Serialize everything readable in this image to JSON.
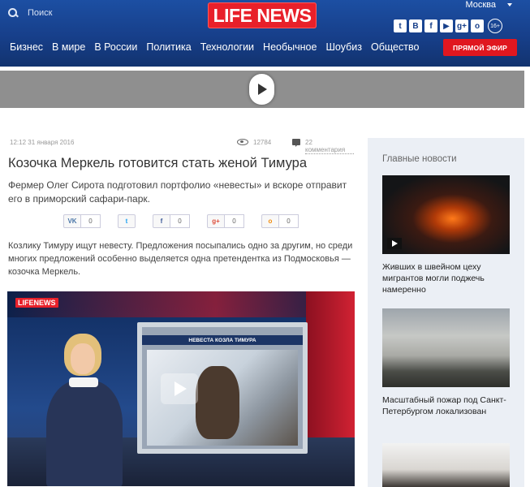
{
  "header": {
    "search_label": "Поиск",
    "logo_part1": "LIFE",
    "logo_part2": "NEWS",
    "city": "Москва",
    "socials": [
      "twitter-icon",
      "vk-icon",
      "facebook-icon",
      "youtube-icon",
      "googleplus-icon",
      "odnoklassniki-icon"
    ],
    "social_glyphs": [
      "t",
      "В",
      "f",
      "▶",
      "g+",
      "о"
    ],
    "age_rating": "16+",
    "nav": [
      "Бизнес",
      "В мире",
      "В России",
      "Политика",
      "Технологии",
      "Необычное",
      "Шоубиз",
      "Общество"
    ],
    "live_button": "ПРЯМОЙ ЭФИР",
    "colors": {
      "header_blue": "#173f8a",
      "brand_red": "#e8202a",
      "live_red": "#e0171f"
    }
  },
  "article": {
    "date": "12:12 31 января 2016",
    "views": "12784",
    "comments": "22 комментария",
    "title": "Козочка Меркель готовится стать женой Тимура",
    "lead": "Фермер Олег Сирота подготовил портфолио «невесты» и вскоре отправит его в приморский сафари-парк.",
    "share": [
      {
        "icon": "vk-icon",
        "glyph": "VK",
        "count": "0"
      },
      {
        "icon": "twitter-icon",
        "glyph": "t",
        "count": ""
      },
      {
        "icon": "facebook-icon",
        "glyph": "f",
        "count": "0"
      },
      {
        "icon": "googleplus-icon",
        "glyph": "g+",
        "count": "0"
      },
      {
        "icon": "odnoklassniki-icon",
        "glyph": "о",
        "count": "0"
      }
    ],
    "body": "Козлику Тимуру ищут невесту. Предложения посыпались одно за другим, но среди многих предложений особенно выделяется одна претендентка из Подмосковья — козочка Меркель.",
    "video": {
      "logo": "LIFENEWS",
      "screen_caption": "НЕВЕСТА КОЗЛА ТИМУРА"
    }
  },
  "sidebar": {
    "heading": "Главные новости",
    "items": [
      {
        "caption": "Живших в швейном цеху мигрантов могли подж​ечь намеренно",
        "has_video": true
      },
      {
        "caption": "Масштабный пожар под Санкт-Петербургом локализован",
        "has_video": false
      },
      {
        "caption": "",
        "has_video": false
      }
    ]
  }
}
